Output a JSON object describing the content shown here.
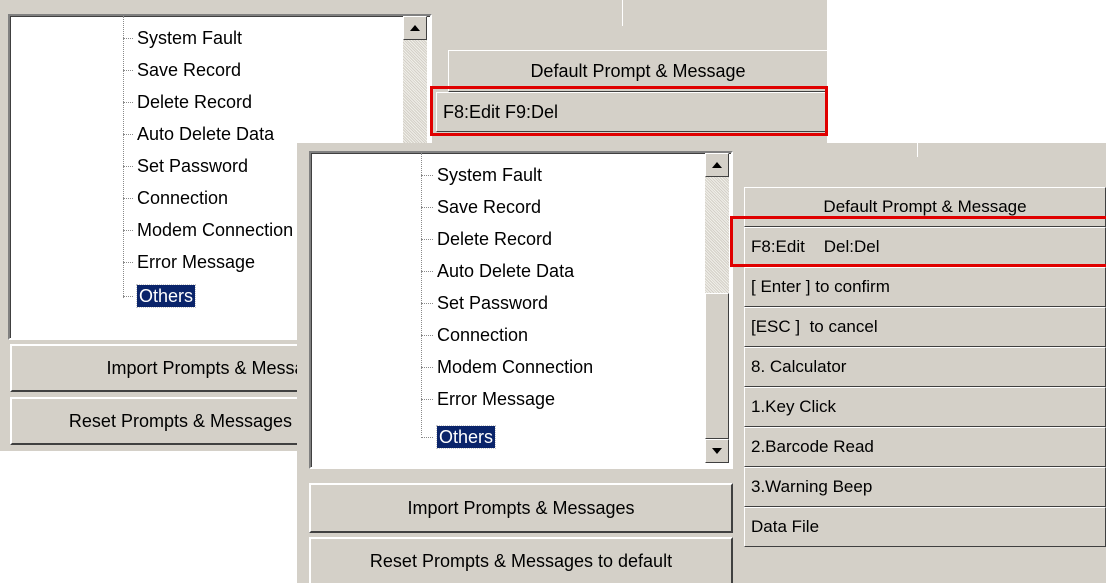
{
  "back": {
    "tree_items": [
      "System Fault",
      "Save Record",
      "Delete Record",
      "Auto Delete Data",
      "Set Password",
      "Connection",
      "Modem Connection",
      "Error Message",
      "Others"
    ],
    "selected_item": "Others",
    "buttons": {
      "import": "Import Prompts & Messages",
      "reset": "Reset Prompts & Messages to default"
    },
    "table": {
      "header": "Default Prompt & Message",
      "rows": [
        "F8:Edit  F9:Del"
      ]
    }
  },
  "front": {
    "tree_items": [
      "System Fault",
      "Save Record",
      "Delete Record",
      "Auto Delete Data",
      "Set Password",
      "Connection",
      "Modem Connection",
      "Error Message",
      "Others"
    ],
    "selected_item": "Others",
    "buttons": {
      "import": "Import Prompts & Messages",
      "reset": "Reset Prompts & Messages to default"
    },
    "table": {
      "header": "Default Prompt & Message",
      "rows": [
        "F8:Edit    Del:Del",
        "[ Enter ] to confirm",
        "[ESC ]  to cancel",
        "8. Calculator",
        "1.Key Click",
        "2.Barcode Read",
        "3.Warning Beep",
        "Data File"
      ]
    }
  },
  "colors": {
    "panel": "#d4d0c8",
    "selection": "#0a246a",
    "highlight_box": "#e00000"
  }
}
